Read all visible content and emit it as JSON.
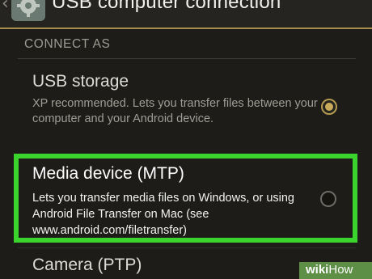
{
  "header": {
    "title": "USB computer connection",
    "back_glyph": "‹",
    "icon": "gear-icon"
  },
  "section": {
    "header": "CONNECT AS"
  },
  "options": [
    {
      "title": "USB storage",
      "summary": "XP recommended. Lets you transfer files between your computer and your Android device.",
      "selected": true
    },
    {
      "title": "Media device (MTP)",
      "summary": "Lets you transfer media files on Windows, or using Android File Transfer on Mac (see www.android.com/filetransfer)",
      "selected": false,
      "highlighted": true
    },
    {
      "title": "Camera (PTP)"
    }
  ],
  "watermark": {
    "wiki": "wiki",
    "how": "How"
  },
  "colors": {
    "accent": "#c9ac5a",
    "highlight": "#3bd42d",
    "background": "#1d1c18"
  }
}
